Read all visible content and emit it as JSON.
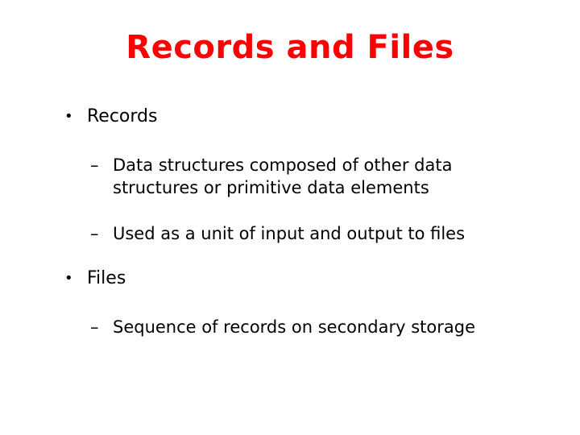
{
  "slide": {
    "title": "Records and Files",
    "bullets": [
      {
        "marker": "•",
        "label": "Records",
        "subitems": [
          {
            "marker": "–",
            "lines": [
              "Data structures composed of other data",
              "structures or primitive data elements"
            ]
          },
          {
            "marker": "–",
            "lines": [
              "Used as a unit of input and output to files"
            ]
          }
        ]
      },
      {
        "marker": "•",
        "label": "Files",
        "subitems": [
          {
            "marker": "–",
            "lines": [
              "Sequence of records on secondary storage"
            ]
          }
        ]
      }
    ],
    "colors": {
      "title": "#ff0000",
      "body": "#000000",
      "background": "#ffffff"
    }
  }
}
